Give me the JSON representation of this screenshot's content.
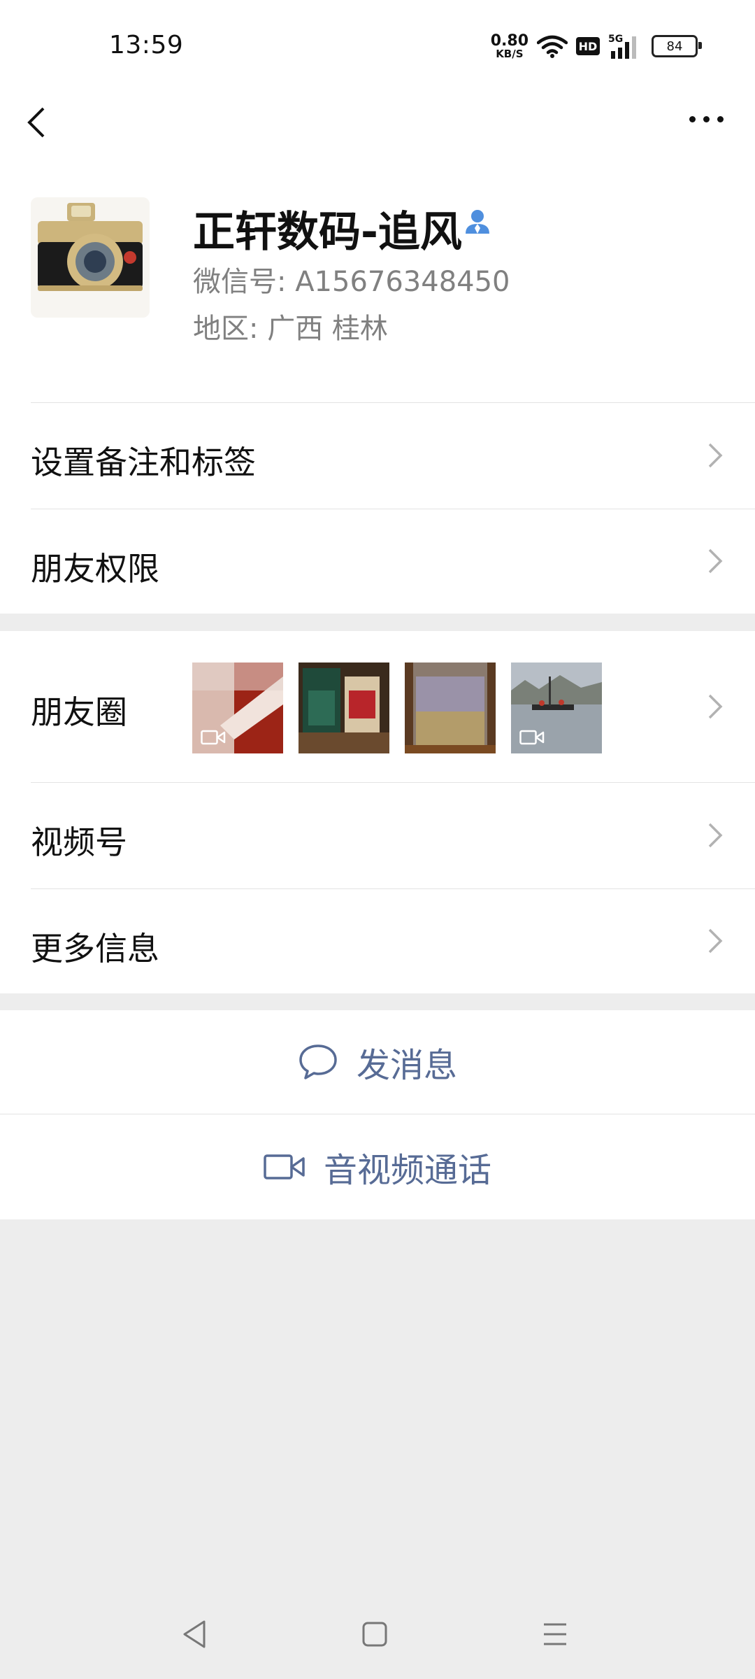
{
  "status_bar": {
    "time": "13:59",
    "net_speed_value": "0.80",
    "net_speed_unit": "KB/S",
    "hd": "HD",
    "network": "5G",
    "battery": "84"
  },
  "profile": {
    "name": "正轩数码-追风",
    "wechat_id": "微信号:  A15676348450",
    "region": "地区:  广西  桂林"
  },
  "rows": {
    "remark": "设置备注和标签",
    "permission": "朋友权限",
    "moments": "朋友圈",
    "channels": "视频号",
    "more_info": "更多信息"
  },
  "actions": {
    "message": "发消息",
    "call": "音视频通话"
  },
  "colors": {
    "accent": "#576b95",
    "background": "#ededed"
  },
  "icons": [
    "back-arrow-icon",
    "more-icon",
    "contact-icon",
    "chevron-right-icon",
    "video-icon",
    "chat-bubble-icon",
    "video-camera-icon",
    "nav-back-icon",
    "nav-home-icon",
    "nav-menu-icon"
  ]
}
